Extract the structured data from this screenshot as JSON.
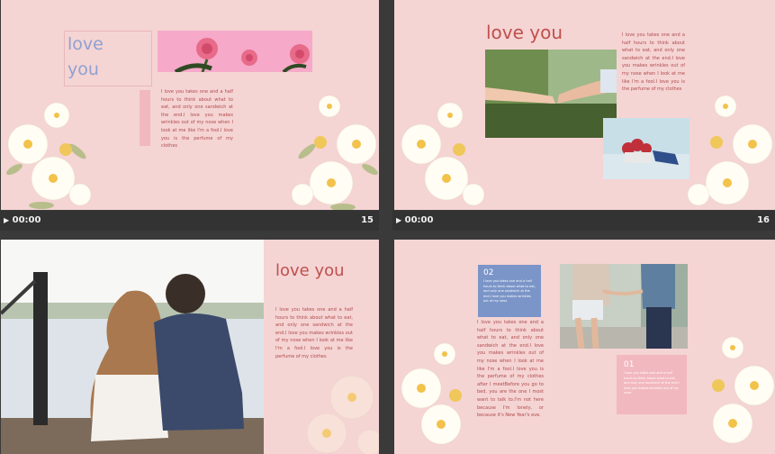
{
  "slide15": {
    "title_line1": "love",
    "title_line2": "you",
    "body": "I love you takes one and a half hours to think about what to eat, and only one sandwich at the end.I love you makes wrinkles out of my nose when I look at me like I'm a fool.I love you is the perfume of my clothes",
    "time": "00:00",
    "number": "15"
  },
  "slide16": {
    "title": "love you",
    "body": "I love you takes one and a half hours to think about what to eat, and only one sandwich at the end.I love you makes wrinkles out of my nose when I look at me like I'm a fool.I love you is the perfume of my clothes",
    "time": "00:00",
    "number": "16"
  },
  "slide17": {
    "title": "love you",
    "body": "I love you takes one and a half hours to think about what to eat, and only one sandwich at the end.I love you makes wrinkles out of my nose when I look at me like I'm a fool.I love you is the perfume of my clothes"
  },
  "slide18": {
    "badge_top": "02",
    "badge_top_text": "I love you takes one and a half hours to think about what to eat, and only one sandwich at the end.I love you makes wrinkles out of my nose",
    "body": "I love you takes one and a half hours to think about what to eat, and only one sandwich at the end.I love you makes wrinkles out of my nose when I look at me like I'm a fool.I love you is the perfume of my clothes after I meetBefore you go to bed, you are the one I most want to talk to.I'm not here because I'm lonely, or because it's New Year's eve.",
    "badge_bottom": "01",
    "badge_bottom_text": "I love you takes one and a half hours to think about what to eat, and only one sandwich at the end.I love you makes wrinkles out of my nose"
  },
  "colors": {
    "slide_bg": "#f5d4d4",
    "accent_red": "#c0504d",
    "accent_blue": "#7b95c8",
    "accent_pink": "#f2b8bf",
    "title_blue": "#8ea2d0"
  }
}
